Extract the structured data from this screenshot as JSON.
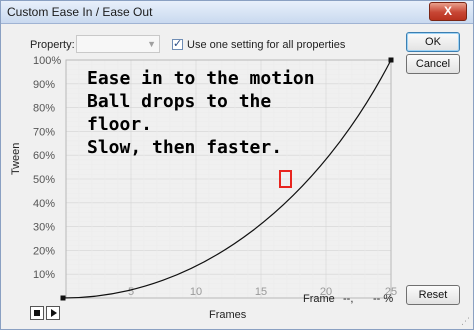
{
  "window": {
    "title": "Custom Ease In / Ease Out",
    "close_label": "X"
  },
  "controls": {
    "property_label": "Property:",
    "property_value": "",
    "checkbox_checked": true,
    "checkbox_label": "Use one setting for all properties"
  },
  "buttons": {
    "ok": "OK",
    "cancel": "Cancel",
    "reset": "Reset"
  },
  "graph": {
    "y_axis_title": "Tween",
    "x_axis_title": "Frames",
    "y_ticks": [
      "100%",
      "90%",
      "80%",
      "70%",
      "60%",
      "50%",
      "40%",
      "30%",
      "20%",
      "10%"
    ],
    "x_ticks": [
      "5",
      "10",
      "15",
      "20",
      "25"
    ],
    "annotation_color": "#e8241e"
  },
  "overlay": {
    "line1": "Ease in to the motion",
    "line2": "Ball drops to the",
    "line3": "floor.",
    "line4": "Slow, then faster."
  },
  "status": {
    "frame_label": "Frame",
    "frame_value": "--,",
    "percent_value": "-- %"
  },
  "playback": {
    "stop_icon": "stop-icon",
    "play_icon": "play-icon"
  }
}
